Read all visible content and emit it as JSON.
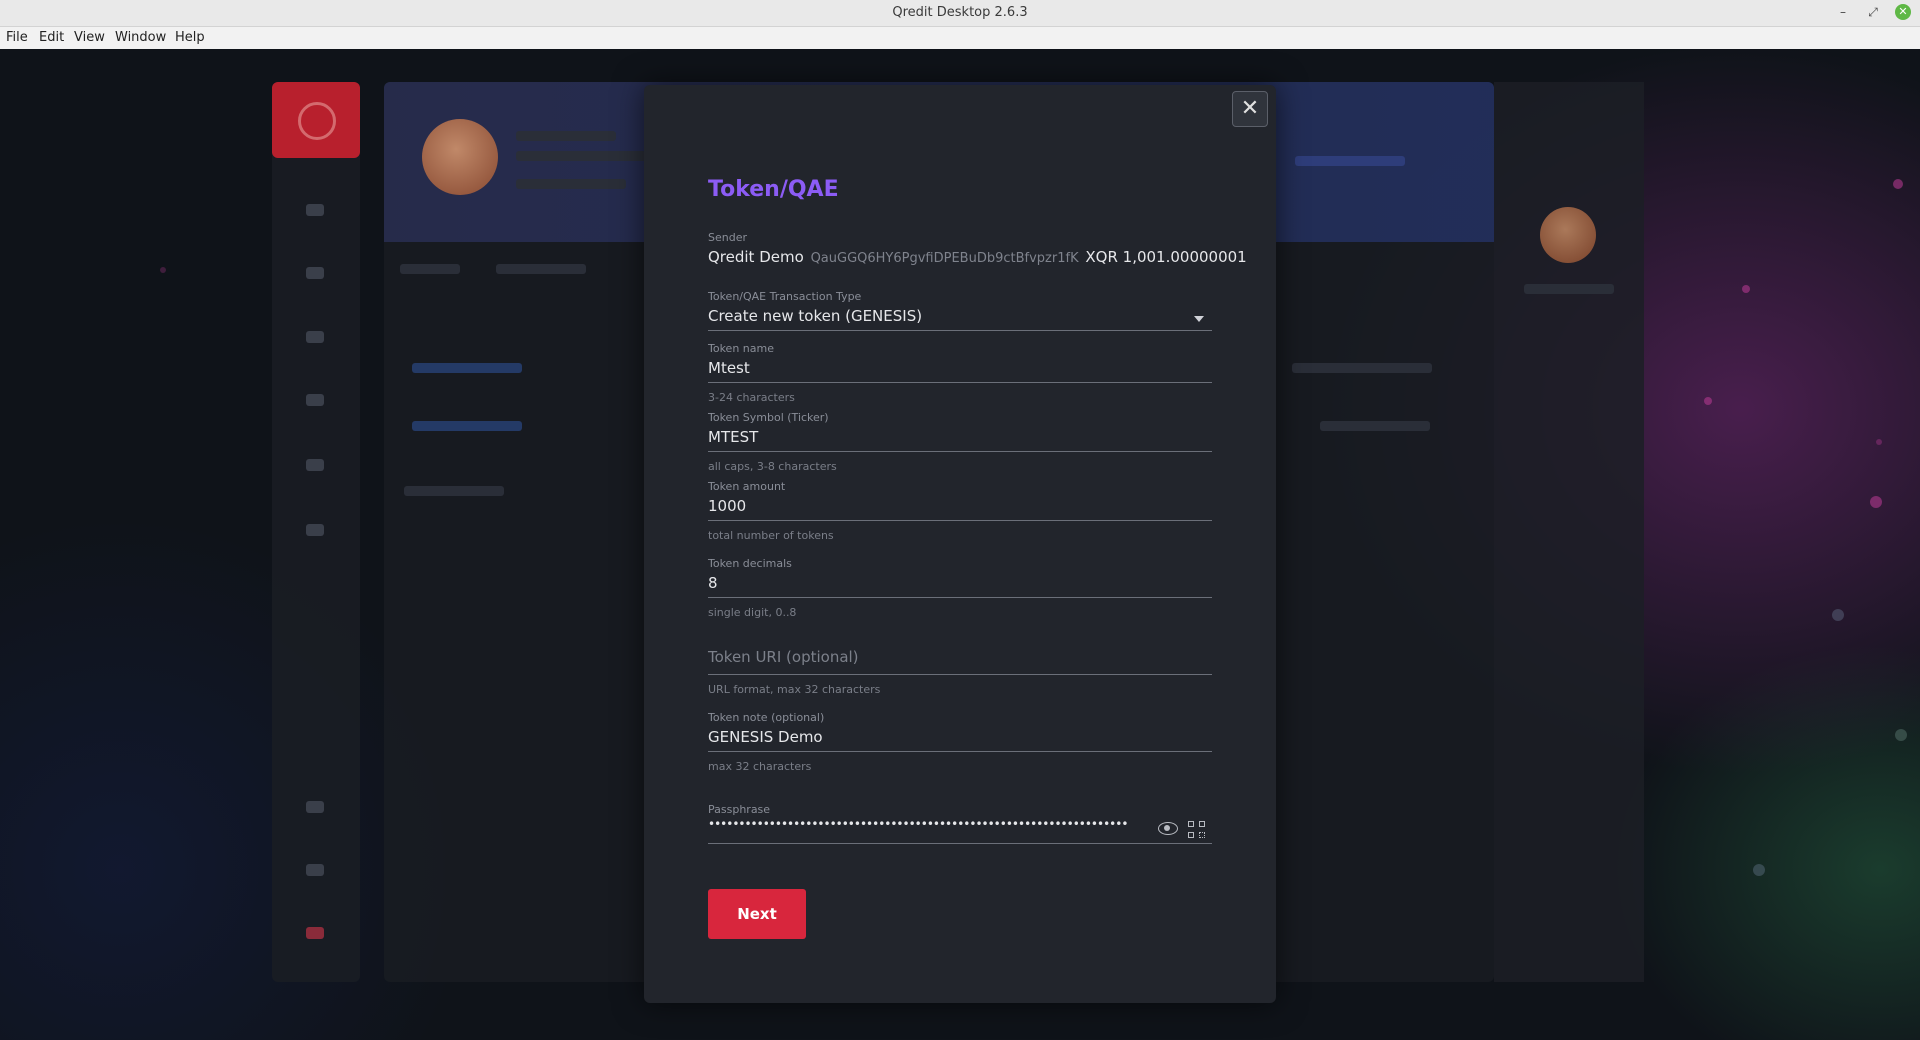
{
  "window": {
    "title": "Qredit Desktop 2.6.3"
  },
  "menu": [
    "File",
    "Edit",
    "View",
    "Window",
    "Help"
  ],
  "modal": {
    "title": "Token/QAE",
    "sender": {
      "label": "Sender",
      "name": "Qredit Demo",
      "address": "QauGGQ6HY6PgvfiDPEBuDb9ctBfvpzr1fK",
      "balance": "XQR 1,001.00000001"
    },
    "type": {
      "label": "Token/QAE Transaction Type",
      "value": "Create new token (GENESIS)"
    },
    "token_name": {
      "label": "Token name",
      "value": "Mtest",
      "hint": "3-24 characters"
    },
    "token_symbol": {
      "label": "Token Symbol (Ticker)",
      "value": "MTEST",
      "hint": "all caps, 3-8 characters"
    },
    "token_amount": {
      "label": "Token amount",
      "value": "1000",
      "hint": "total number of tokens"
    },
    "token_decimals": {
      "label": "Token decimals",
      "value": "8",
      "hint": "single digit, 0..8"
    },
    "token_uri": {
      "placeholder": "Token URI (optional)",
      "hint": "URL format, max 32 characters"
    },
    "token_note": {
      "label": "Token note (optional)",
      "value": "GENESIS Demo",
      "hint": "max 32 characters"
    },
    "passphrase": {
      "label": "Passphrase",
      "masked": "••••••••••••••••••••••••••••••••••••••••••••••••••••••••••••••••••••••"
    },
    "next_label": "Next",
    "close_symbol": "✕"
  },
  "icons": [
    "close-icon",
    "chevron-down-icon",
    "eye-icon",
    "qr-code-icon",
    "minimize-icon",
    "maximize-icon",
    "window-close-icon"
  ]
}
